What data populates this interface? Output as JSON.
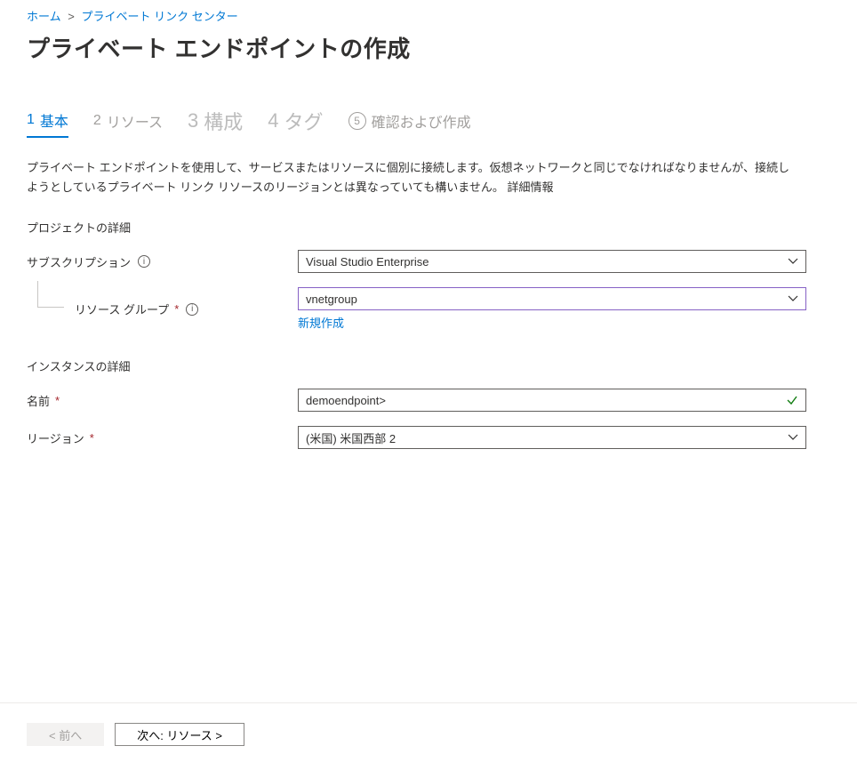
{
  "breadcrumb": {
    "home": "ホーム",
    "sep": ">",
    "linkCenter": "プライベート リンク センター"
  },
  "title": "プライベート エンドポイントの作成",
  "tabs": {
    "basics": {
      "num": "1",
      "label": "基本"
    },
    "resource": {
      "num": "2",
      "label": "リソース"
    },
    "config": {
      "num": "3",
      "label": "構成"
    },
    "tags": {
      "num": "4",
      "label": "タグ"
    },
    "review": {
      "num": "5",
      "label": "確認および作成"
    }
  },
  "description": "プライベート エンドポイントを使用して、サービスまたはリソースに個別に接続します。仮想ネットワークと同じでなければなりませんが、接続しようとしているプライベート リンク リソースのリージョンとは異なっていても構いません。 詳細情報",
  "sections": {
    "project": "プロジェクトの詳細",
    "instance": "インスタンスの詳細"
  },
  "fields": {
    "subscription": {
      "label": "サブスクリプション",
      "value": "Visual Studio Enterprise"
    },
    "resourceGroup": {
      "label": "リソース グループ",
      "value": "vnetgroup",
      "newLink": "新規作成"
    },
    "name": {
      "label": "名前",
      "value": "demoendpoint>"
    },
    "region": {
      "label": "リージョン",
      "value": "(米国) 米国西部 2"
    }
  },
  "footer": {
    "prev": "<  前へ",
    "next": "次へ:  リソース  >"
  },
  "required": "*"
}
